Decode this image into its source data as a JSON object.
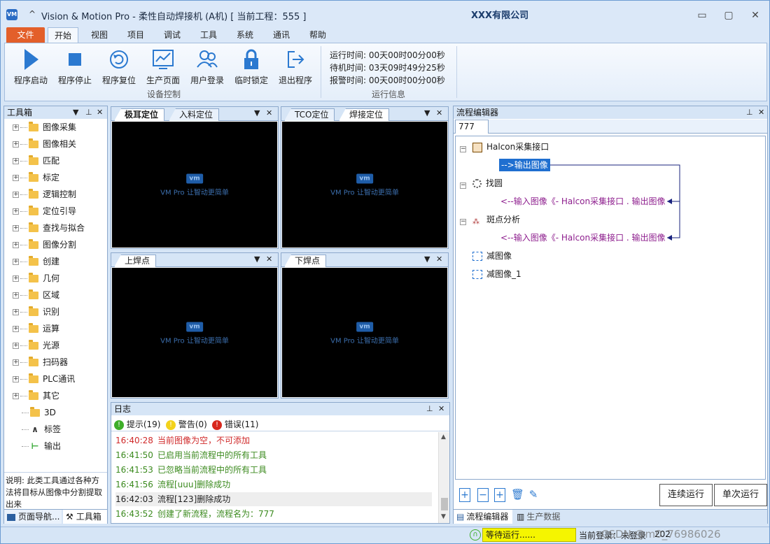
{
  "window": {
    "app_icon": "VM",
    "quick_access": "^",
    "title": "Vision & Motion Pro - 柔性自动焊接机 (A机)    [ 当前工程：555 ]",
    "company": "XXX有限公司",
    "minimize": "▭",
    "maximize": "▢",
    "close": "✕"
  },
  "ribbon": {
    "tabs": [
      "文件",
      "开始",
      "视图",
      "项目",
      "调试",
      "工具",
      "系统",
      "通讯",
      "帮助"
    ],
    "active_tab": "开始",
    "buttons": [
      {
        "label": "程序启动",
        "icon": "play-icon"
      },
      {
        "label": "程序停止",
        "icon": "stop-icon"
      },
      {
        "label": "程序复位",
        "icon": "reset-icon"
      },
      {
        "label": "生产页面",
        "icon": "chart-icon"
      },
      {
        "label": "用户登录",
        "icon": "users-icon"
      },
      {
        "label": "临时锁定",
        "icon": "lock-icon"
      },
      {
        "label": "退出程序",
        "icon": "exit-icon"
      }
    ],
    "group_device": "设备控制",
    "group_info": "运行信息",
    "run_time": "运行时间: 00天00时00分00秒",
    "idle_time": "待机时间: 03天09时49分25秒",
    "alarm_time": "报警时间: 00天00时00分00秒"
  },
  "toolbox": {
    "title": "工具箱",
    "items": [
      "图像采集",
      "图像相关",
      "匹配",
      "标定",
      "逻辑控制",
      "定位引导",
      "查找与拟合",
      "图像分割",
      "创建",
      "几何",
      "区域",
      "识别",
      "运算",
      "光源",
      "扫码器",
      "PLC通讯",
      "其它",
      "3D",
      "标签",
      "输出"
    ],
    "description": "说明: 此类工具通过各种方法将目标从图像中分割提取出来",
    "tab_nav": "页面导航...",
    "tab_tools": "工具箱"
  },
  "views": {
    "logo_text": "vm",
    "slogan": "VM Pro 让智动更简单",
    "v1_tabs": [
      "极耳定位",
      "入料定位"
    ],
    "v2_tabs": [
      "TCO定位",
      "焊接定位"
    ],
    "v3_tabs": [
      "上焊点"
    ],
    "v4_tabs": [
      "下焊点"
    ],
    "dropdown": "▼",
    "close": "✕"
  },
  "log": {
    "title": "日志",
    "hint": "提示(19)",
    "warn": "警告(0)",
    "error": "错误(11)",
    "rows": [
      {
        "time": "16:40:28",
        "msg": "当前图像为空，不可添加",
        "color": "#d02a2a"
      },
      {
        "time": "16:41:50",
        "msg": "已启用当前流程中的所有工具",
        "color": "#3b8a1e"
      },
      {
        "time": "16:41:53",
        "msg": "已忽略当前流程中的所有工具",
        "color": "#3b8a1e"
      },
      {
        "time": "16:41:56",
        "msg": "流程[uuu]删除成功",
        "color": "#3b8a1e"
      },
      {
        "time": "16:42:03",
        "msg": "流程[123]删除成功",
        "color": "#222222"
      },
      {
        "time": "16:43:52",
        "msg": "创建了新流程，流程名为：777",
        "color": "#3b8a1e"
      }
    ]
  },
  "flow": {
    "title": "流程编辑器",
    "tab": "777",
    "node1": "Halcon采集接口",
    "node1_out": "-->输出图像",
    "node2": "找圆",
    "node2_in": "<--输入图像《- Halcon采集接口 . 输出图像",
    "node3": "斑点分析",
    "node3_in": "<--输入图像《- Halcon采集接口 . 输出图像",
    "node4": "减图像",
    "node5": "减图像_1",
    "continuous_run": "连续运行",
    "single_run": "单次运行",
    "tab_flow": "流程编辑器",
    "tab_data": "生产数据"
  },
  "status": {
    "waiting": "等待运行......",
    "login": "当前登录：未登录",
    "date": "202",
    "watermark": "CSDN @m0_76986026"
  }
}
